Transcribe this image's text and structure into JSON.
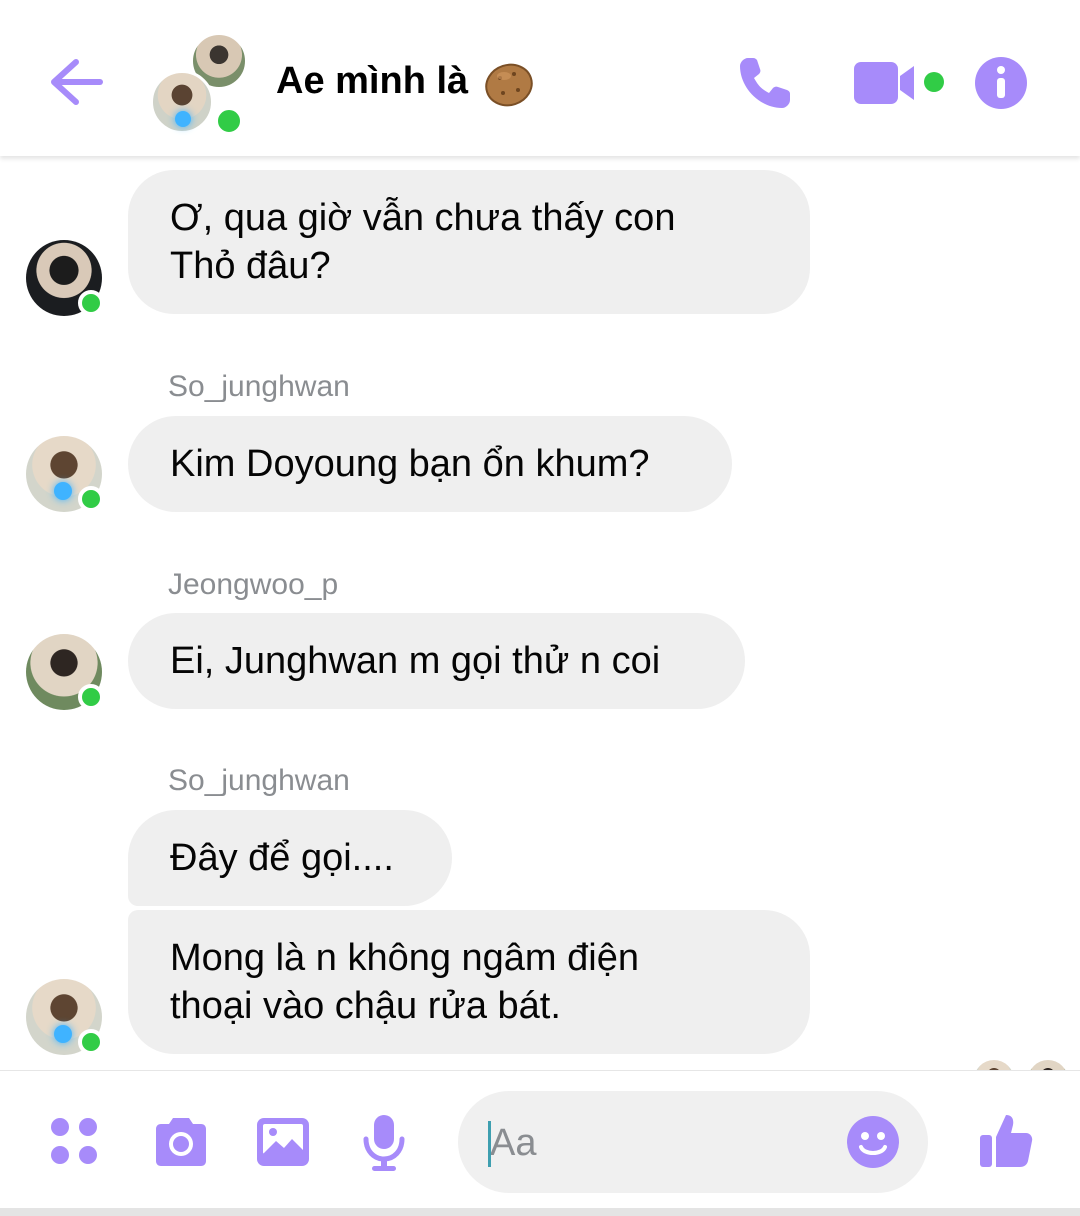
{
  "header": {
    "title": "Ae mình là",
    "title_emoji": "potato-icon"
  },
  "messages": [
    {
      "sender": "",
      "lines": [
        "Ơ, qua giờ vẫn chưa thấy con",
        "Thỏ đâu?"
      ]
    },
    {
      "sender": "So_junghwan",
      "lines": [
        "Kim Doyoung bạn ổn khum?"
      ]
    },
    {
      "sender": "Jeongwoo_p",
      "lines": [
        "Ei, Junghwan m gọi thử n coi"
      ]
    },
    {
      "sender": "So_junghwan",
      "lines": [
        "Đây để gọi...."
      ]
    },
    {
      "sender": "",
      "lines": [
        "Mong là n không ngâm điện",
        "thoại vào chậu rửa bát."
      ]
    }
  ],
  "composer": {
    "placeholder": "Aa"
  },
  "colors": {
    "accent": "#a78bfa",
    "online": "#31cc46",
    "bubble": "#efefef",
    "sender_text": "#8a8d91"
  }
}
